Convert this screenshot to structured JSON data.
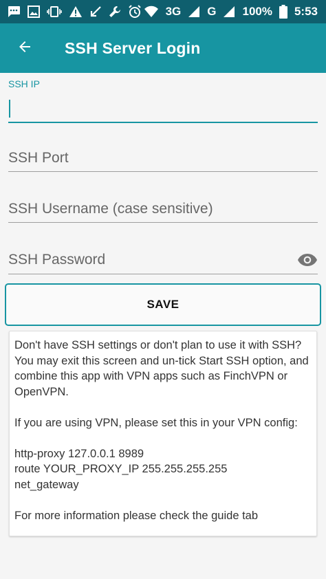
{
  "status_bar": {
    "icons_left": [
      "chat-icon",
      "image-icon",
      "vibrate-icon",
      "warning-icon",
      "missed-call-icon",
      "wrench-icon",
      "alarm-icon"
    ],
    "network_3g": "3G",
    "network_g": "G",
    "battery": "100%",
    "time": "5:53"
  },
  "app_bar": {
    "title": "SSH Server Login"
  },
  "form": {
    "ssh_ip": {
      "label": "SSH IP",
      "value": ""
    },
    "ssh_port": {
      "placeholder": "SSH Port",
      "value": ""
    },
    "ssh_username": {
      "placeholder": "SSH Username (case sensitive)",
      "value": ""
    },
    "ssh_password": {
      "placeholder": "SSH Password",
      "value": ""
    },
    "save_label": "SAVE"
  },
  "info": {
    "paragraph1": "Don't have SSH settings or don't plan to use it with SSH? You may exit this screen and un-tick Start SSH option, and combine this app with VPN apps such as FinchVPN or OpenVPN.",
    "paragraph2": "If you are using VPN, please set this in your VPN config:",
    "config_line1": "http-proxy 127.0.0.1 8989",
    "config_line2": "route YOUR_PROXY_IP 255.255.255.255",
    "config_line3": "net_gateway",
    "paragraph3": "For more information please check the guide tab"
  },
  "colors": {
    "status_bar": "#0f5f6e",
    "app_bar": "#1795a2",
    "accent": "#1795a2",
    "background": "#f5f5f5"
  }
}
